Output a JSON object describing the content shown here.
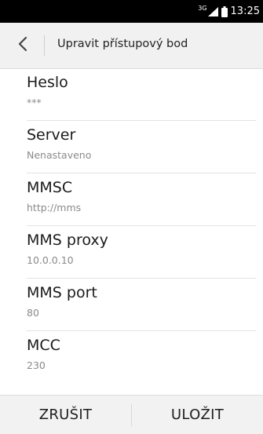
{
  "status_bar": {
    "network_type": "3G",
    "time": "13:25",
    "signal_icon": "signal-bars-icon",
    "battery_icon": "battery-icon"
  },
  "header": {
    "back_icon": "chevron-left-icon",
    "title": "Upravit přístupový bod"
  },
  "settings": [
    {
      "title": "Heslo",
      "value": "***"
    },
    {
      "title": "Server",
      "value": "Nenastaveno"
    },
    {
      "title": "MMSC",
      "value": "http://mms"
    },
    {
      "title": "MMS proxy",
      "value": "10.0.0.10"
    },
    {
      "title": "MMS port",
      "value": "80"
    },
    {
      "title": "MCC",
      "value": "230"
    }
  ],
  "actions": {
    "cancel_label": "ZRUŠIT",
    "save_label": "ULOŽIT"
  },
  "colors": {
    "status_bar_bg": "#000000",
    "header_bg": "#f1f1f1",
    "action_bar_bg": "#f2f2f2",
    "secondary_text": "#8a8a8a"
  }
}
